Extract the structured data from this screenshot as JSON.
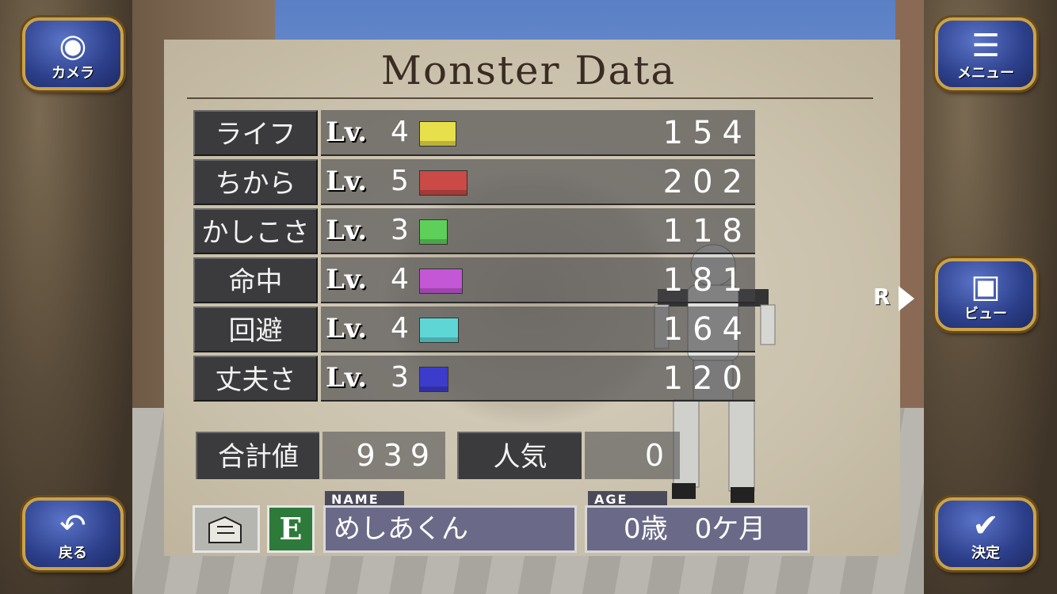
{
  "title": "Monster Data",
  "stats": [
    {
      "label": "ライフ",
      "lv_prefix": "Lv.",
      "level": "4",
      "bar_color": "#e8e04a",
      "bar_fill": 0.154,
      "value": "154"
    },
    {
      "label": "ちから",
      "lv_prefix": "Lv.",
      "level": "5",
      "bar_color": "#c94a46",
      "bar_fill": 0.202,
      "value": "202"
    },
    {
      "label": "かしこさ",
      "lv_prefix": "Lv.",
      "level": "3",
      "bar_color": "#5ed05a",
      "bar_fill": 0.118,
      "value": "118"
    },
    {
      "label": "命中",
      "lv_prefix": "Lv.",
      "level": "4",
      "bar_color": "#c457d6",
      "bar_fill": 0.181,
      "value": "181"
    },
    {
      "label": "回避",
      "lv_prefix": "Lv.",
      "level": "4",
      "bar_color": "#5fd6d6",
      "bar_fill": 0.164,
      "value": "164"
    },
    {
      "label": "丈夫さ",
      "lv_prefix": "Lv.",
      "level": "3",
      "bar_color": "#3c3ccc",
      "bar_fill": 0.12,
      "value": "120"
    }
  ],
  "summary": {
    "total_label": "合計値",
    "total_value": "939",
    "popularity_label": "人気",
    "popularity_value": "0"
  },
  "profile": {
    "equip_letter": "E",
    "name_tag": "NAME",
    "name_value": "めしあくん",
    "age_tag": "AGE",
    "age_value": "0歳　0ケ月"
  },
  "buttons": {
    "camera": "カメラ",
    "menu": "メニュー",
    "view": "ビュー",
    "back": "戻る",
    "confirm": "決定"
  },
  "view_indicator": "R"
}
